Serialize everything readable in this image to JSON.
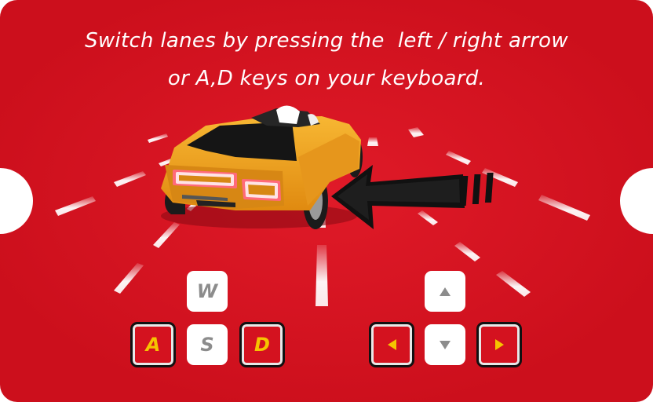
{
  "instruction": {
    "line1": "Switch lanes by pressing the  left / right arrow",
    "line2": "or A,D keys on your keyboard."
  },
  "keys": {
    "wasd": {
      "w": "W",
      "a": "A",
      "s": "S",
      "d": "D"
    },
    "arrows": {
      "up": "arrow-up-icon",
      "left": "arrow-left-icon",
      "down": "arrow-down-icon",
      "right": "arrow-right-icon"
    },
    "active_keys": [
      "A",
      "D",
      "left",
      "right"
    ]
  },
  "scene": {
    "car": "sports-car",
    "hint": "arrow-pointing-left-icon"
  },
  "colors": {
    "background_red": "#d4121f",
    "key_face": "#ffffff",
    "key_active_fill": "#d4121f",
    "key_active_label": "#f5c400",
    "car_body": "#f2a51f",
    "arrow": "#111111"
  }
}
